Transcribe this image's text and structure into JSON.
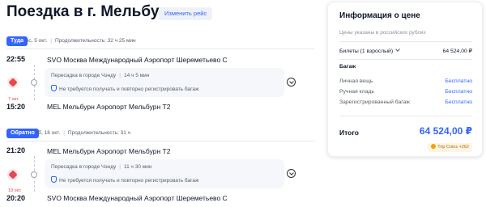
{
  "header": {
    "title": "Поездка в г. Мельбурн",
    "change_button": "Изменить рейс"
  },
  "outbound": {
    "badge": "Туда",
    "date": "вс, 5 окт.",
    "duration": "Продолжительность: 32 ч 25 мин",
    "departure": {
      "time": "22:55",
      "airport": "SVO Москва Международный Аэропорт Шереметьево C"
    },
    "transfer": {
      "text": "Пересадка в городе Чэнду",
      "duration": "14 ч 5 мин",
      "baggage": "Не требуется получать и повторно регистрировать багаж"
    },
    "arrival": {
      "date_note": "7 окт.",
      "time": "15:20",
      "airport": "MEL Мельбурн Аэропорт Мельбурн T2"
    }
  },
  "return": {
    "badge": "Обратно",
    "date": "сб, 18 окт.",
    "duration": "Продолжительность: 31 ч",
    "departure": {
      "time": "21:20",
      "airport": "MEL Мельбурн Аэропорт Мельбурн T2"
    },
    "transfer": {
      "text": "Пересадка в городе Чэнду",
      "duration": "11 ч 30 мин",
      "baggage": "Не требуется получать и повторно регистрировать багаж"
    },
    "arrival": {
      "date_note": "19 окт.",
      "time": "20:20",
      "airport": "SVO Москва Международный Аэропорт Шереметьево C"
    }
  },
  "price_card": {
    "title": "Информация о цене",
    "note": "Цены указаны в российских рублях",
    "tickets_label": "Билеты (1 взрослый)",
    "tickets_value": "64 524,00 ₽",
    "baggage_title": "Багаж",
    "baggage_items": [
      {
        "label": "Личная вещь",
        "value": "Бесплатно"
      },
      {
        "label": "Ручная кладь",
        "value": "Бесплатно"
      },
      {
        "label": "Зарегистрированный багаж",
        "value": "Бесплатно"
      }
    ],
    "total_label": "Итого",
    "total_value": "64 524,00 ₽",
    "coins": "Trip Coins +262"
  },
  "colors": {
    "accent": "#3264ff",
    "airline": "#e5484d"
  }
}
